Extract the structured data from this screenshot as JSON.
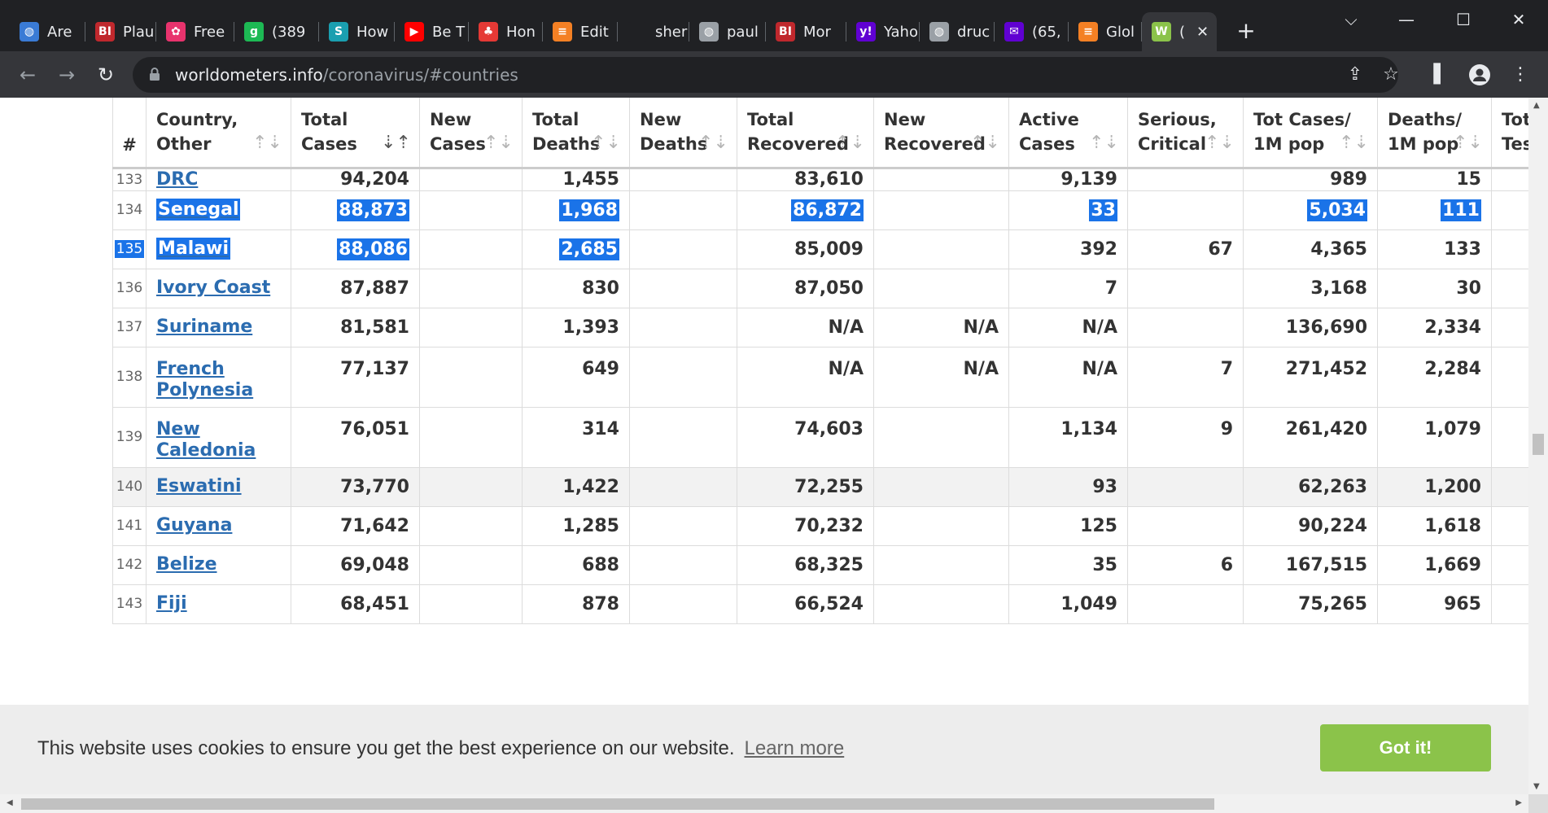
{
  "browser": {
    "tabs": [
      {
        "label": "Are",
        "icon": "globe-icon",
        "color": "#3a7bd5"
      },
      {
        "label": "Plau",
        "icon": "bi-icon",
        "color": "#c0282d"
      },
      {
        "label": "Free",
        "icon": "flower-icon",
        "color": "#e8336d"
      },
      {
        "label": "(389",
        "icon": "g-icon",
        "color": "#1db954"
      },
      {
        "label": "How",
        "icon": "stat-icon",
        "color": "#1a9fb0"
      },
      {
        "label": "Be T",
        "icon": "youtube-icon",
        "color": "#ff0000"
      },
      {
        "label": "Hon",
        "icon": "tree-icon",
        "color": "#e53935"
      },
      {
        "label": "Edit",
        "icon": "stack-icon",
        "color": "#f48024"
      },
      {
        "label": "sher",
        "icon": "blank-icon",
        "color": "#202124"
      },
      {
        "label": "paul",
        "icon": "globe-icon",
        "color": "#9aa0a6"
      },
      {
        "label": "Mor",
        "icon": "bi-icon",
        "color": "#c0282d"
      },
      {
        "label": "Yaho",
        "icon": "yahoo-icon",
        "color": "#6001d2"
      },
      {
        "label": "druc",
        "icon": "globe-icon",
        "color": "#9aa0a6"
      },
      {
        "label": "(65,",
        "icon": "mail-icon",
        "color": "#6001d2"
      },
      {
        "label": "Glol",
        "icon": "stack-icon",
        "color": "#f48024"
      },
      {
        "label": "(",
        "icon": "w-icon",
        "color": "#8bc34a",
        "active": true
      }
    ],
    "url_host": "worldometers.info",
    "url_path": "/coronavirus/#countries",
    "window_controls": {
      "chevron": "⌵",
      "minimize": "—",
      "maximize": "☐",
      "close": "✕"
    }
  },
  "table": {
    "headers": [
      {
        "line1": "#",
        "line2": ""
      },
      {
        "line1": "Country,",
        "line2": "Other"
      },
      {
        "line1": "Total",
        "line2": "Cases"
      },
      {
        "line1": "New",
        "line2": "Cases"
      },
      {
        "line1": "Total",
        "line2": "Deaths"
      },
      {
        "line1": "New",
        "line2": "Deaths"
      },
      {
        "line1": "Total",
        "line2": "Recovered"
      },
      {
        "line1": "New",
        "line2": "Recovered"
      },
      {
        "line1": "Active",
        "line2": "Cases"
      },
      {
        "line1": "Serious,",
        "line2": "Critical"
      },
      {
        "line1": "Tot Cases/",
        "line2": "1M pop"
      },
      {
        "line1": "Deaths/",
        "line2": "1M pop"
      },
      {
        "line1": "Tot",
        "line2": "Tes"
      }
    ],
    "rows": [
      {
        "rank": "133",
        "country": "DRC",
        "country2": "",
        "total_cases": "94,204",
        "new_cases": "",
        "total_deaths": "1,455",
        "new_deaths": "",
        "total_recovered": "83,610",
        "new_recovered": "",
        "active": "9,139",
        "serious": "",
        "cases_1m": "989",
        "deaths_1m": "15"
      },
      {
        "rank": "134",
        "country": "Senegal",
        "country2": "",
        "total_cases": "88,873",
        "new_cases": "",
        "total_deaths": "1,968",
        "new_deaths": "",
        "total_recovered": "86,872",
        "new_recovered": "",
        "active": "33",
        "serious": "",
        "cases_1m": "5,034",
        "deaths_1m": "111"
      },
      {
        "rank": "135",
        "country": "Malawi",
        "country2": "",
        "total_cases": "88,086",
        "new_cases": "",
        "total_deaths": "2,685",
        "new_deaths": "",
        "total_recovered": "85,009",
        "new_recovered": "",
        "active": "392",
        "serious": "67",
        "cases_1m": "4,365",
        "deaths_1m": "133"
      },
      {
        "rank": "136",
        "country": "Ivory Coast",
        "country2": "",
        "total_cases": "87,887",
        "new_cases": "",
        "total_deaths": "830",
        "new_deaths": "",
        "total_recovered": "87,050",
        "new_recovered": "",
        "active": "7",
        "serious": "",
        "cases_1m": "3,168",
        "deaths_1m": "30"
      },
      {
        "rank": "137",
        "country": "Suriname",
        "country2": "",
        "total_cases": "81,581",
        "new_cases": "",
        "total_deaths": "1,393",
        "new_deaths": "",
        "total_recovered": "N/A",
        "new_recovered": "N/A",
        "active": "N/A",
        "serious": "",
        "cases_1m": "136,690",
        "deaths_1m": "2,334"
      },
      {
        "rank": "138",
        "country": "French",
        "country2": "Polynesia",
        "total_cases": "77,137",
        "new_cases": "",
        "total_deaths": "649",
        "new_deaths": "",
        "total_recovered": "N/A",
        "new_recovered": "N/A",
        "active": "N/A",
        "serious": "7",
        "cases_1m": "271,452",
        "deaths_1m": "2,284"
      },
      {
        "rank": "139",
        "country": "New",
        "country2": "Caledonia",
        "total_cases": "76,051",
        "new_cases": "",
        "total_deaths": "314",
        "new_deaths": "",
        "total_recovered": "74,603",
        "new_recovered": "",
        "active": "1,134",
        "serious": "9",
        "cases_1m": "261,420",
        "deaths_1m": "1,079"
      },
      {
        "rank": "140",
        "country": "Eswatini",
        "country2": "",
        "total_cases": "73,770",
        "new_cases": "",
        "total_deaths": "1,422",
        "new_deaths": "",
        "total_recovered": "72,255",
        "new_recovered": "",
        "active": "93",
        "serious": "",
        "cases_1m": "62,263",
        "deaths_1m": "1,200"
      },
      {
        "rank": "141",
        "country": "Guyana",
        "country2": "",
        "total_cases": "71,642",
        "new_cases": "",
        "total_deaths": "1,285",
        "new_deaths": "",
        "total_recovered": "70,232",
        "new_recovered": "",
        "active": "125",
        "serious": "",
        "cases_1m": "90,224",
        "deaths_1m": "1,618"
      },
      {
        "rank": "142",
        "country": "Belize",
        "country2": "",
        "total_cases": "69,048",
        "new_cases": "",
        "total_deaths": "688",
        "new_deaths": "",
        "total_recovered": "68,325",
        "new_recovered": "",
        "active": "35",
        "serious": "6",
        "cases_1m": "167,515",
        "deaths_1m": "1,669"
      },
      {
        "rank": "143",
        "country": "Fiji",
        "country2": "",
        "total_cases": "68,451",
        "new_cases": "",
        "total_deaths": "878",
        "new_deaths": "",
        "total_recovered": "66,524",
        "new_recovered": "",
        "active": "1,049",
        "serious": "",
        "cases_1m": "75,265",
        "deaths_1m": "965"
      }
    ]
  },
  "cookie_banner": {
    "message": "This website uses cookies to ensure you get the best experience on our website.",
    "learn_more": "Learn more",
    "accept": "Got it!"
  }
}
